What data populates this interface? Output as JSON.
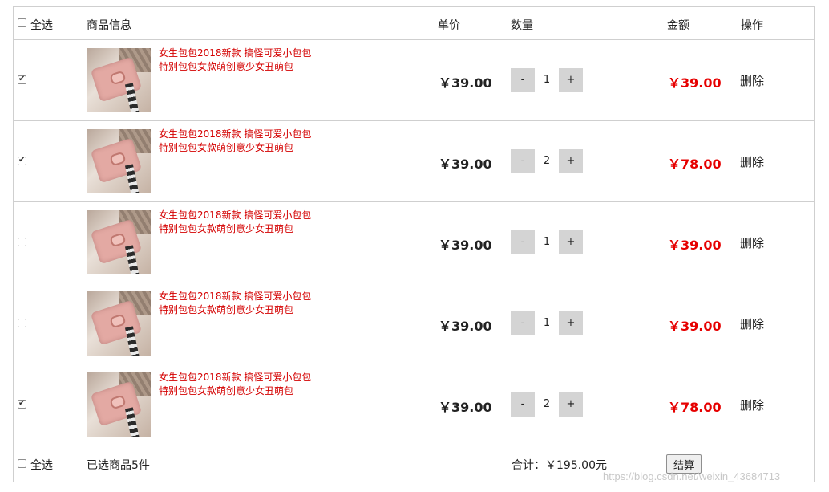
{
  "header": {
    "select_all_label": "全选",
    "col_product": "商品信息",
    "col_unit_price": "单价",
    "col_quantity": "数量",
    "col_amount": "金额",
    "col_action": "操作"
  },
  "items": [
    {
      "checked": true,
      "title": "女生包包2018新款 搞怪可爱小包包特别包包女款萌创意少女丑萌包",
      "unit_price": "￥39.00",
      "quantity": "1",
      "amount": "￥39.00",
      "delete_label": "删除",
      "minus": "-",
      "plus": "+"
    },
    {
      "checked": true,
      "title": "女生包包2018新款 搞怪可爱小包包特别包包女款萌创意少女丑萌包",
      "unit_price": "￥39.00",
      "quantity": "2",
      "amount": "￥78.00",
      "delete_label": "删除",
      "minus": "-",
      "plus": "+"
    },
    {
      "checked": false,
      "title": "女生包包2018新款 搞怪可爱小包包特别包包女款萌创意少女丑萌包",
      "unit_price": "￥39.00",
      "quantity": "1",
      "amount": "￥39.00",
      "delete_label": "删除",
      "minus": "-",
      "plus": "+"
    },
    {
      "checked": false,
      "title": "女生包包2018新款 搞怪可爱小包包特别包包女款萌创意少女丑萌包",
      "unit_price": "￥39.00",
      "quantity": "1",
      "amount": "￥39.00",
      "delete_label": "删除",
      "minus": "-",
      "plus": "+"
    },
    {
      "checked": true,
      "title": "女生包包2018新款 搞怪可爱小包包特别包包女款萌创意少女丑萌包",
      "unit_price": "￥39.00",
      "quantity": "2",
      "amount": "￥78.00",
      "delete_label": "删除",
      "minus": "-",
      "plus": "+"
    }
  ],
  "footer": {
    "select_all_label": "全选",
    "selected_count_text": "已选商品5件",
    "total_text": "合计：￥195.00元",
    "checkout_label": "结算"
  },
  "watermark": "https://blog.csdn.net/weixin_43684713",
  "colors": {
    "accent_red": "#e60000",
    "title_red": "#d40000",
    "border": "#cfcfcf",
    "qty_button_bg": "#d4d4d4"
  }
}
